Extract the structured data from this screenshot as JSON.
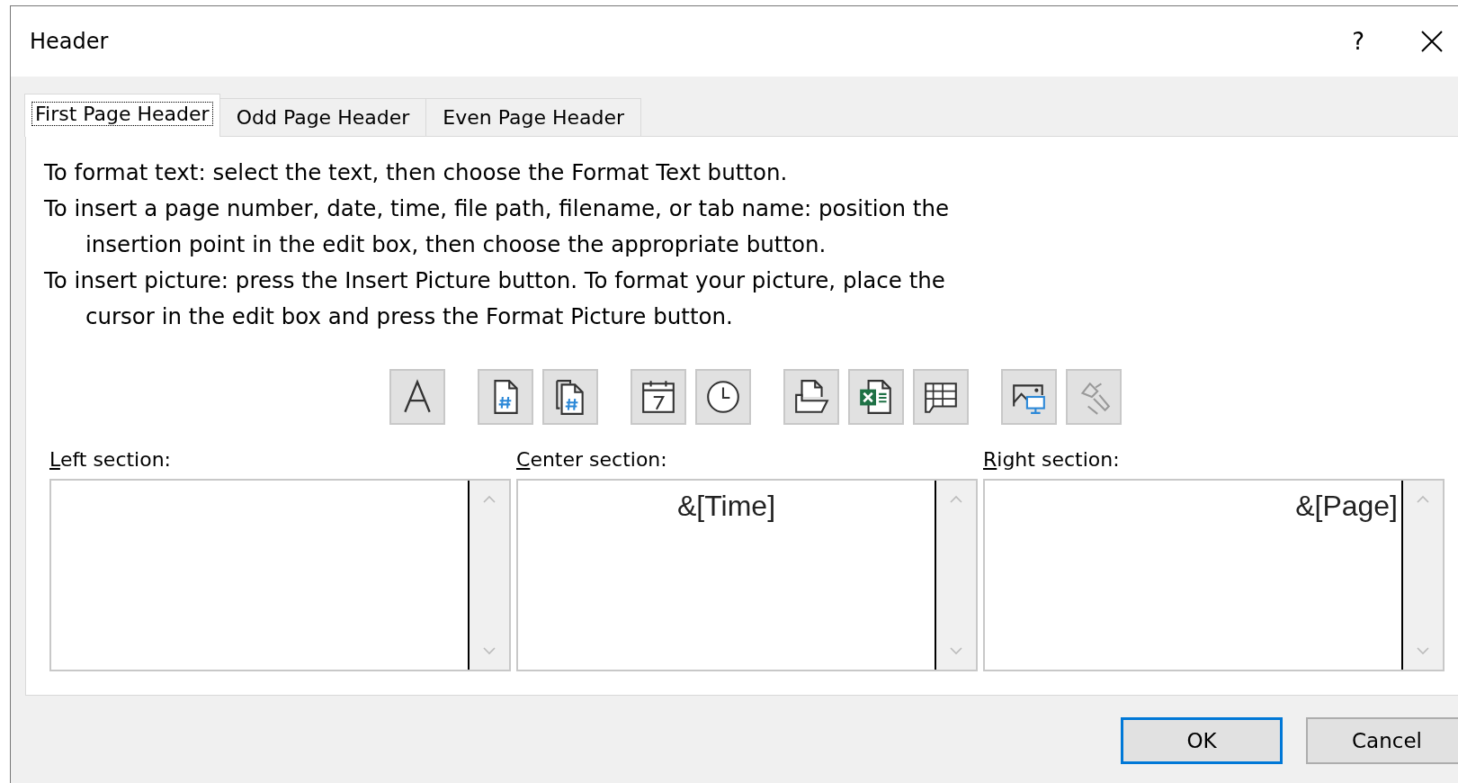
{
  "window": {
    "title": "Header",
    "help": "?"
  },
  "tabs": [
    {
      "label": "First Page Header",
      "selected": true
    },
    {
      "label": "Odd Page Header",
      "selected": false
    },
    {
      "label": "Even Page Header",
      "selected": false
    }
  ],
  "instructions": [
    {
      "text": "To format text:  select the text, then choose the Format Text button.",
      "indented": false
    },
    {
      "text": "To insert a page number, date, time, file path, filename, or tab name:  position the",
      "indented": false
    },
    {
      "text": "insertion point in the edit box, then choose the appropriate button.",
      "indented": true
    },
    {
      "text": "To insert picture: press the Insert Picture button.  To format your picture, place the",
      "indented": false
    },
    {
      "text": "cursor in the edit box and press the Format Picture button.",
      "indented": true
    }
  ],
  "toolbar_groups": [
    [
      {
        "kind": "format-text",
        "disabled": false
      }
    ],
    [
      {
        "kind": "page-number",
        "disabled": false
      },
      {
        "kind": "page-count",
        "disabled": false
      }
    ],
    [
      {
        "kind": "date",
        "disabled": false
      },
      {
        "kind": "time",
        "disabled": false
      }
    ],
    [
      {
        "kind": "file-path",
        "disabled": false
      },
      {
        "kind": "file-name",
        "disabled": false
      },
      {
        "kind": "sheet-name",
        "disabled": false
      }
    ],
    [
      {
        "kind": "insert-picture",
        "disabled": false
      },
      {
        "kind": "format-picture",
        "disabled": true
      }
    ]
  ],
  "sections": [
    {
      "label": "Left section:"
    },
    {
      "label": "Center section:",
      "value": "&[Time]"
    },
    {
      "label": "Right section:",
      "value": "&[Page]"
    }
  ],
  "buttons": [
    {
      "label": "OK",
      "default": true
    },
    {
      "label": "Cancel",
      "default": false
    }
  ]
}
